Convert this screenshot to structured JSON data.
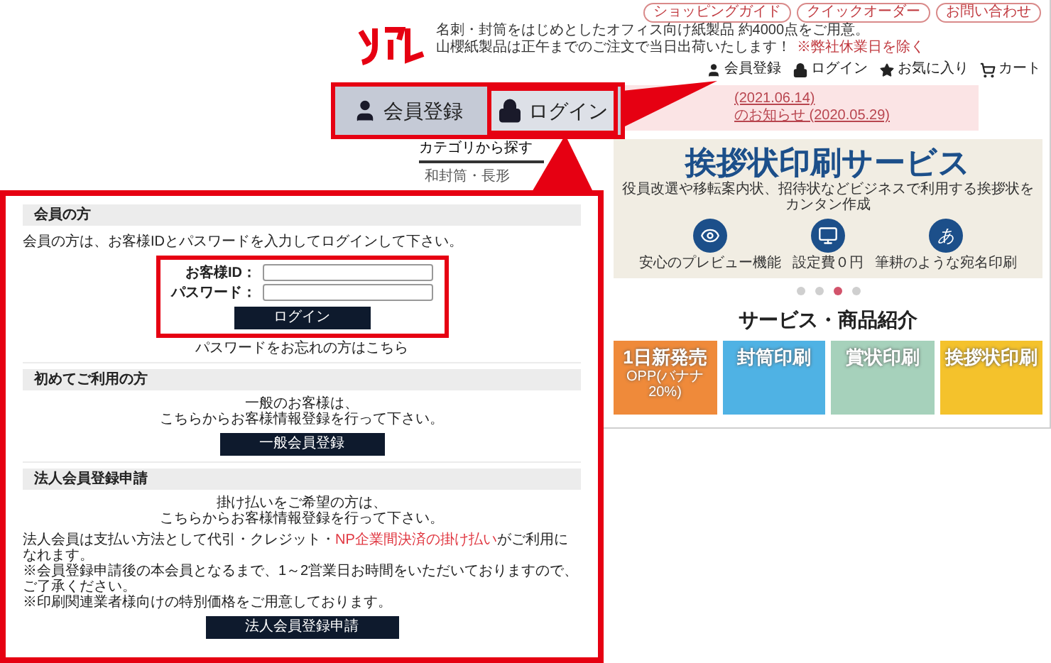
{
  "site": {
    "header_links": [
      "ショッピングガイド",
      "クイックオーダー",
      "お問い合わせ"
    ],
    "tagline": "名刺・封筒をはじめとしたオフィス向け紙製品 約4000点をご用意。",
    "shipping_note": "山櫻紙製品は正午までのご注文で当日出荷いたします！",
    "shipping_footnote": "※弊社休業日を除く",
    "nav": [
      {
        "label": "会員登録"
      },
      {
        "label": "ログイン"
      },
      {
        "label": "お気に入り"
      },
      {
        "label": "カート"
      }
    ],
    "notices": [
      "(2021.06.14)",
      "のお知らせ (2020.05.29)"
    ],
    "category": {
      "title": "カテゴリから探す",
      "items": [
        "和封筒・長形"
      ]
    },
    "banner": {
      "title": "挨拶状印刷サービス",
      "subtitle": "役員改選や移転案内状、招待状などビジネスで利用する挨拶状をカンタン作成",
      "features": [
        {
          "label": "安心のプレビュー機能"
        },
        {
          "label": "設定費０円"
        },
        {
          "glyph": "あ",
          "label": "筆耕のような宛名印刷"
        }
      ],
      "dots": [
        {
          "selected": false
        },
        {
          "selected": false
        },
        {
          "selected": true
        },
        {
          "selected": false
        }
      ]
    },
    "section_title": "サービス・商品紹介",
    "products": [
      {
        "title": "1日新発売",
        "subtitle": "OPP(バナナ20%)",
        "color": "#ef8a3a"
      },
      {
        "title": "封筒印刷",
        "color": "#4fb2e4"
      },
      {
        "title": "賞状印刷",
        "color": "#a6d1bb"
      },
      {
        "title": "挨拶状印刷",
        "color": "#f4c22c"
      }
    ]
  },
  "callout": {
    "items": [
      {
        "label": "会員登録",
        "highlighted": false
      },
      {
        "label": "ログイン",
        "highlighted": true
      }
    ]
  },
  "login_panel": {
    "sections": [
      {
        "kind": "login",
        "title": "会員の方",
        "intro": "会員の方は、お客様IDとパスワードを入力してログインして下さい。",
        "highlighted": true,
        "fields": [
          {
            "label": "お客様ID："
          },
          {
            "label": "パスワード："
          }
        ],
        "button": "ログイン",
        "link": "パスワードをお忘れの方はこちら"
      },
      {
        "kind": "register",
        "title": "初めてご利用の方",
        "lines": [
          "一般のお客様は、",
          "こちらからお客様情報登録を行って下さい。"
        ],
        "button": "一般会員登録"
      },
      {
        "kind": "register",
        "title": "法人会員登録申請",
        "lines": [
          "掛け払いをご希望の方は、",
          "こちらからお客様情報登録を行って下さい。"
        ],
        "notes": [
          [
            {
              "text": "法人会員は支払い方法として代引・クレジット・"
            },
            {
              "text": "NP企業間決済の掛け払い",
              "link": true
            },
            {
              "text": "がご利用になれます。"
            }
          ],
          [
            {
              "text": "※会員登録申請後の本会員となるまで、1～2営業日お時間をいただいておりますので、ご了承ください。"
            }
          ],
          [
            {
              "text": "※印刷関連業者様向けの特別価格をご用意しております。"
            }
          ]
        ],
        "button": "法人会員登録申請"
      }
    ]
  }
}
